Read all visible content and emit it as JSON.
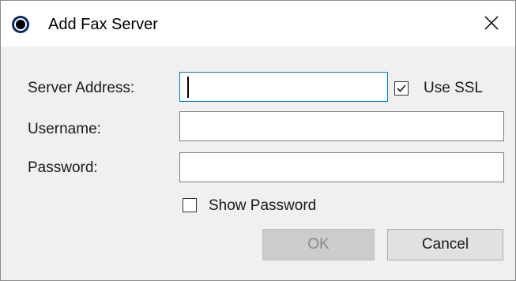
{
  "window": {
    "title": "Add Fax Server",
    "close_glyph": "close-icon",
    "app_icon": "radio-dot-icon"
  },
  "form": {
    "server_address_label": "Server Address:",
    "server_address_value": "",
    "use_ssl_label": "Use SSL",
    "use_ssl_checked": true,
    "username_label": "Username:",
    "username_value": "",
    "password_label": "Password:",
    "password_value": "",
    "show_password_label": "Show Password",
    "show_password_checked": false
  },
  "buttons": {
    "ok_label": "OK",
    "ok_enabled": false,
    "cancel_label": "Cancel"
  },
  "colors": {
    "focus_border": "#0078d7",
    "dialog_bg": "#f0f0f0",
    "disabled_button_bg": "#cccccc"
  }
}
